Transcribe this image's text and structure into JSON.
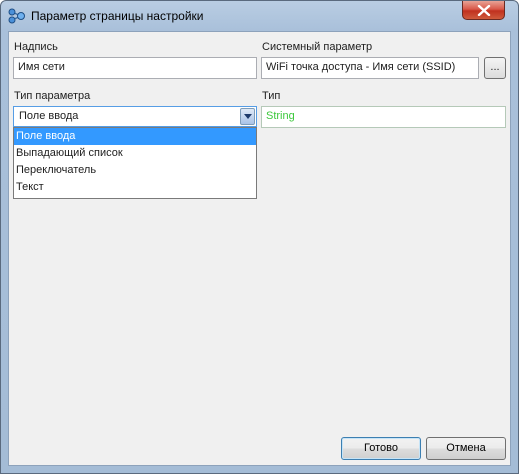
{
  "window": {
    "title": "Параметр страницы настройки",
    "app_icon": "network-nodes-icon",
    "close_icon": "close-icon"
  },
  "form": {
    "caption_label": "Надпись",
    "caption_value": "Имя сети",
    "system_param_label": "Системный параметр",
    "system_param_value": "WiFi точка доступа - Имя сети (SSID)",
    "browse_label": "...",
    "param_type_label": "Тип параметра",
    "param_type_selected": "Поле ввода",
    "param_type_options": [
      "Поле ввода",
      "Выпадающий список",
      "Переключатель",
      "Текст"
    ],
    "type_label": "Тип",
    "type_value": "String",
    "type_value_color": "#3cc83c"
  },
  "buttons": {
    "ok_label": "Готово",
    "cancel_label": "Отмена"
  }
}
